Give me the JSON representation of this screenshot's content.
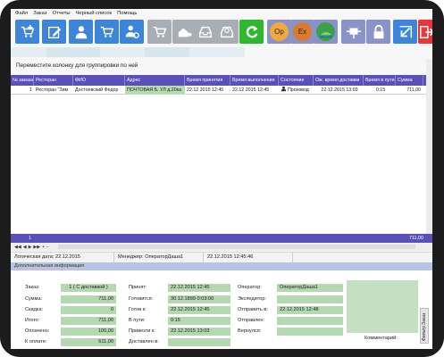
{
  "menu": [
    "Файл",
    "Заказ",
    "Отчеты",
    "Черный список",
    "Помощь"
  ],
  "toolbar": {
    "icons": [
      "new-order-icon",
      "edit-order-icon",
      "user-icon",
      "cart-icon",
      "courier-cart-icon",
      "cart-disabled-icon",
      "home-truck-icon",
      "inbox-icon",
      "inbox-clock-icon",
      "refresh-icon",
      "op-icon",
      "ex-icon",
      "map-icon",
      "network-icon",
      "lock-icon",
      "exit-arrow-icon",
      "logout-icon"
    ],
    "op_label": "Op",
    "ex_label": "Ex"
  },
  "grid": {
    "group_hint": "Переместите колонку для группировки по ней",
    "columns": [
      "№ заказа",
      "Ресторан",
      "ФИО",
      "Адрес",
      "Время принятия",
      "Время выполнения",
      "Состояние",
      "Ож. время доставки",
      "Время в пути",
      "Сумма"
    ],
    "row": {
      "num": "1",
      "restaurant": "Ресторан \"Зим",
      "fio": "Достоевский Федор",
      "address": "ПОЧТОВАЯ Б. УЛ д.20ка",
      "accepted": "22.12.2015 12:45",
      "done": "22.12.2015 12:45",
      "status": "Производ",
      "expected": "22.12.2015 13:03",
      "transit": "0:15",
      "sum": "711,00"
    },
    "total_count": "1",
    "total_sum": "711,00"
  },
  "status": {
    "logical_date": "Логическая дата: 22.12.2015",
    "manager": "Менеджер: ОператорДаша1",
    "datetime": "22.12.2015 12:45:46"
  },
  "details": {
    "title": "Дополнительная информация",
    "order_label": "Заказ:",
    "order_value": "1    ( С доставкой )",
    "sum_label": "Сумма:",
    "sum_value": "711,00",
    "discount_label": "Скидка:",
    "discount_value": "0",
    "total_label": "Итого:",
    "total_value": "711,00",
    "paid_label": "Оплачено:",
    "paid_value": "100,00",
    "topay_label": "К оплате:",
    "topay_value": "611,00",
    "accepted_label": "Принят:",
    "accepted_value": "22.12.2015 12:45",
    "ready_label": "Готовится:",
    "ready_value": "30.12.1899 0:03:00",
    "readyat_label": "Готов к:",
    "readyat_value": "22.12.2015 12:45",
    "transit_label": "В пути:",
    "transit_value": "0:15",
    "bring_label": "Привезти к:",
    "bring_value": "22.12.2015 13:03",
    "delivered_label": "Доставлен в:",
    "delivered_value": "",
    "operator_label": "Оператор:",
    "operator_value": "ОператорДаша1",
    "expeditor_label": "Экспедитор:",
    "expeditor_value": "",
    "sendat_label": "Отправить в:",
    "sendat_value": "22.12.2015 12:48",
    "sent_label": "Отправлен:",
    "sent_value": "",
    "returned_label": "Вернулся:",
    "returned_value": "",
    "comment_label": "Комментарий:",
    "side_tab": "Фильтр  Заказ"
  }
}
